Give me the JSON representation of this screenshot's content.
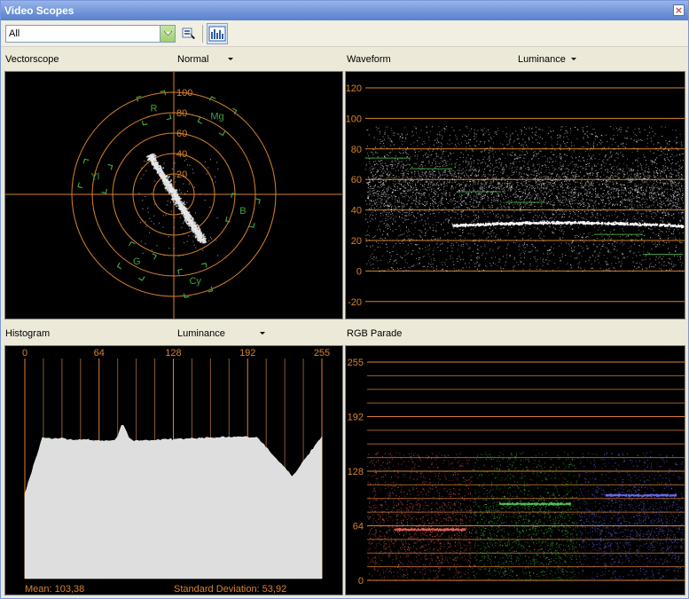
{
  "window": {
    "title": "Video Scopes"
  },
  "toolbar": {
    "dropdown_value": "All",
    "picker_icon": "eyedropper-icon",
    "scopes_icon": "scope-bars-icon"
  },
  "vectorscope": {
    "title": "Vectorscope",
    "mode": "Normal",
    "rings": [
      "100",
      "80",
      "60",
      "40",
      "20"
    ],
    "targets": [
      "R",
      "Mg",
      "Yl",
      "B",
      "G",
      "Cy"
    ]
  },
  "waveform": {
    "title": "Waveform",
    "mode": "Luminance",
    "scale": [
      "120",
      "100",
      "80",
      "60",
      "40",
      "20",
      "0",
      "-20"
    ]
  },
  "histogram": {
    "title": "Histogram",
    "mode": "Luminance",
    "scale": [
      "0",
      "64",
      "128",
      "192",
      "255"
    ],
    "mean": "Mean: 103,38",
    "std": "Standard Deviation: 53,92"
  },
  "rgb_parade": {
    "title": "RGB Parade",
    "scale": [
      "255",
      "192",
      "128",
      "64",
      "0"
    ]
  },
  "colors": {
    "scope_grid": "#d9832b",
    "vector_target": "#3fa13f",
    "trace": "#e6e6e6"
  }
}
